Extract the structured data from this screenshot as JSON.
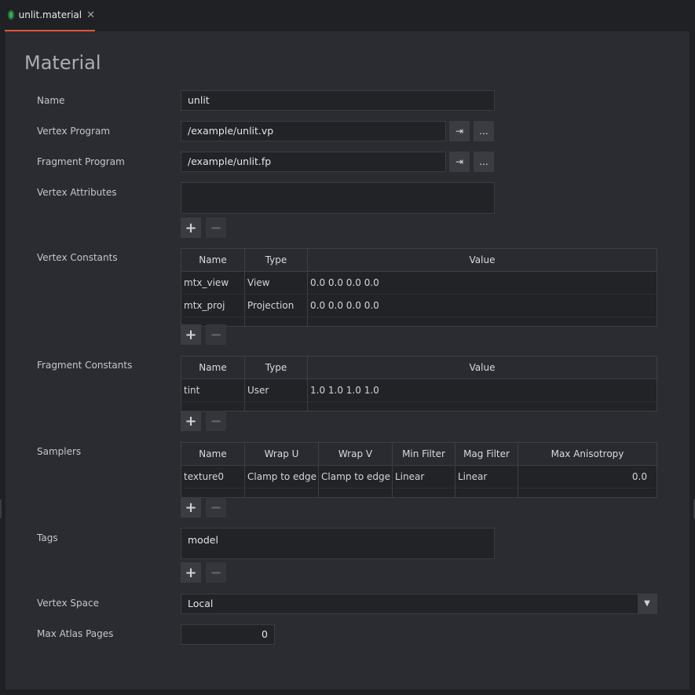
{
  "tab": {
    "title": "unlit.material",
    "close": "✕"
  },
  "header": {
    "title": "Material"
  },
  "fields": {
    "name": {
      "label": "Name",
      "value": "unlit"
    },
    "vertex_program": {
      "label": "Vertex Program",
      "value": "/example/unlit.vp"
    },
    "fragment_program": {
      "label": "Fragment Program",
      "value": "/example/unlit.fp"
    },
    "vertex_attributes": {
      "label": "Vertex Attributes"
    },
    "vertex_constants": {
      "label": "Vertex Constants",
      "columns": [
        "Name",
        "Type",
        "Value"
      ],
      "rows": [
        [
          "mtx_view",
          "View",
          "0.0  0.0  0.0  0.0"
        ],
        [
          "mtx_proj",
          "Projection",
          "0.0  0.0  0.0  0.0"
        ]
      ]
    },
    "fragment_constants": {
      "label": "Fragment Constants",
      "columns": [
        "Name",
        "Type",
        "Value"
      ],
      "rows": [
        [
          "tint",
          "User",
          "1.0  1.0  1.0  1.0"
        ]
      ]
    },
    "samplers": {
      "label": "Samplers",
      "columns": [
        "Name",
        "Wrap U",
        "Wrap V",
        "Min Filter",
        "Mag Filter",
        "Max Anisotropy"
      ],
      "rows": [
        [
          "texture0",
          "Clamp to edge",
          "Clamp to edge",
          "Linear",
          "Linear",
          "0.0"
        ]
      ]
    },
    "tags": {
      "label": "Tags",
      "value": "model"
    },
    "vertex_space": {
      "label": "Vertex Space",
      "value": "Local"
    },
    "max_atlas_pages": {
      "label": "Max Atlas Pages",
      "value": "0"
    }
  },
  "buttons": {
    "goto": "⇥",
    "browse": "...",
    "add": "+",
    "remove": "−",
    "dropdown": "▼"
  },
  "colors": {
    "accent": "#e0563a",
    "panel": "#2b2c31",
    "field": "#222327"
  }
}
